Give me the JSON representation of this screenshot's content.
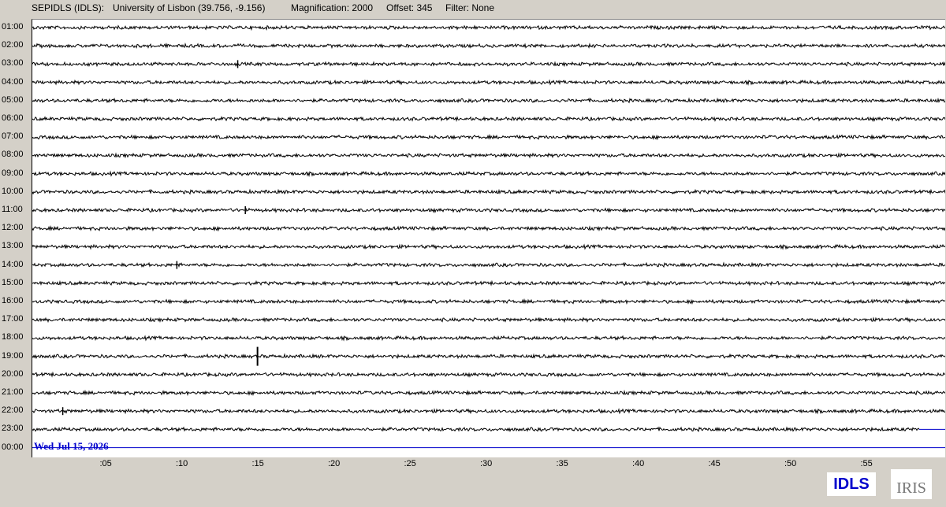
{
  "header": {
    "station": "SEPIDLS (IDLS):",
    "location": "University of Lisbon (39.756, -9.156)",
    "magnification": "Magnification: 2000",
    "offset": "Offset: 345",
    "filter": "Filter: None"
  },
  "helicorder": {
    "hour_labels": [
      "01:00",
      "02:00",
      "03:00",
      "04:00",
      "05:00",
      "06:00",
      "07:00",
      "08:00",
      "09:00",
      "10:00",
      "11:00",
      "12:00",
      "13:00",
      "14:00",
      "15:00",
      "16:00",
      "17:00",
      "18:00",
      "19:00",
      "20:00",
      "21:00",
      "22:00",
      "23:00",
      "00:00"
    ],
    "minute_labels": [
      ":05",
      ":10",
      ":15",
      ":20",
      ":25",
      ":30",
      ":35",
      ":40",
      ":45",
      ":50",
      ":55"
    ],
    "date_label": "Wed Jul 15, 2026",
    "trace_color": "#000000",
    "current_line_color": "#0000cc",
    "events": [
      {
        "hour_label": "03:00",
        "minute": 13.5
      },
      {
        "hour_label": "11:00",
        "minute": 14.0
      },
      {
        "hour_label": "14:00",
        "minute": 9.5
      },
      {
        "hour_label": "19:00",
        "minute": 14.8
      },
      {
        "hour_label": "22:00",
        "minute": 2.0
      }
    ]
  },
  "logos": {
    "station_code": "IDLS",
    "network": "IRIS"
  }
}
